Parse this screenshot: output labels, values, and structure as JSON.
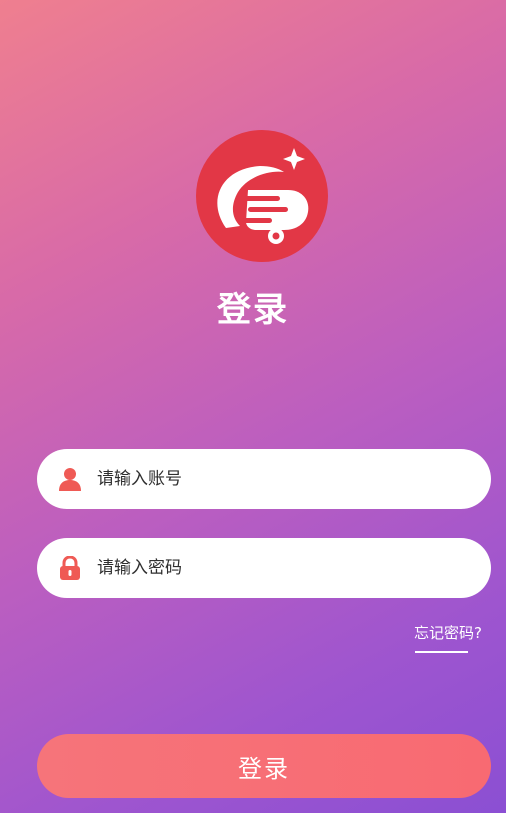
{
  "title": "登录",
  "account_field": {
    "placeholder": "请输入账号",
    "icon": "user-icon"
  },
  "password_field": {
    "placeholder": "请输入密码",
    "icon": "lock-icon"
  },
  "forgot_password": "忘记密码?",
  "login_button": "登录",
  "colors": {
    "logo_red": "#e23746",
    "button": "#f86a72",
    "icon": "#ef5a55",
    "text_white": "#ffffff"
  }
}
